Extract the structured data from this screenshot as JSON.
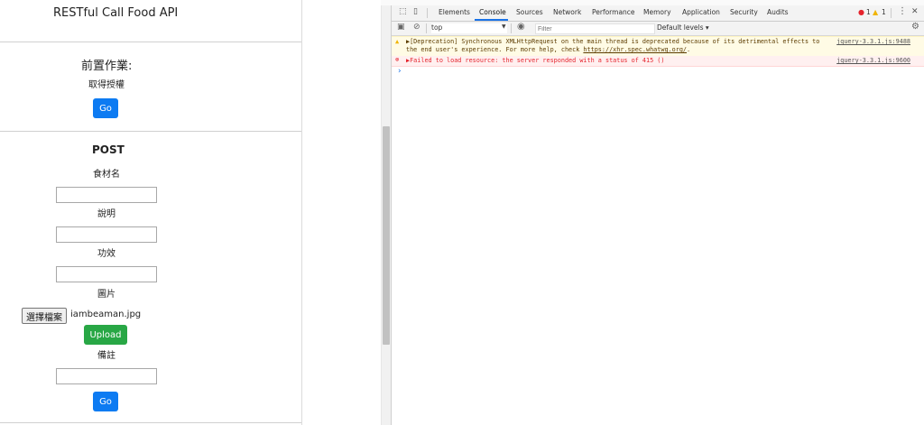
{
  "page": {
    "title": "RESTful Call Food API",
    "pre": {
      "heading": "前置作業:",
      "subheading": "取得授權",
      "go_label": "Go"
    },
    "post": {
      "heading": "POST",
      "field1_label": "食材名",
      "field2_label": "說明",
      "field3_label": "功效",
      "image_label": "圖片",
      "file_button_label": "選擇檔案",
      "file_name": "iambeaman.jpg",
      "upload_label": "Upload",
      "remark_label": "備註",
      "go_label": "Go"
    }
  },
  "devtools": {
    "tabs": [
      "Elements",
      "Console",
      "Sources",
      "Network",
      "Performance",
      "Memory",
      "Application",
      "Security",
      "Audits"
    ],
    "active_tab": "Console",
    "error_count": "1",
    "warning_count": "1",
    "context": "top",
    "filter_placeholder": "Filter",
    "levels_label": "Default levels ▾",
    "warning": {
      "line1": "▶[Deprecation] Synchronous XMLHttpRequest on the main thread is deprecated because of its detrimental effects to",
      "line2_prefix": "the end user's experience. For more help, check ",
      "line2_link": "https://xhr.spec.whatwg.org/",
      "line2_suffix": ".",
      "source": "jquery-3.3.1.js:9488"
    },
    "error": {
      "text": "▶Failed to load resource: the server responded with a status of 415 ()",
      "source": "jquery-3.3.1.js:9600"
    },
    "prompt": "›"
  },
  "colors": {
    "primary": "#0d7bf2",
    "success": "#28a745",
    "accent": "#1a73e8",
    "error": "#e5232c",
    "warning_bg": "#fffbe5"
  }
}
